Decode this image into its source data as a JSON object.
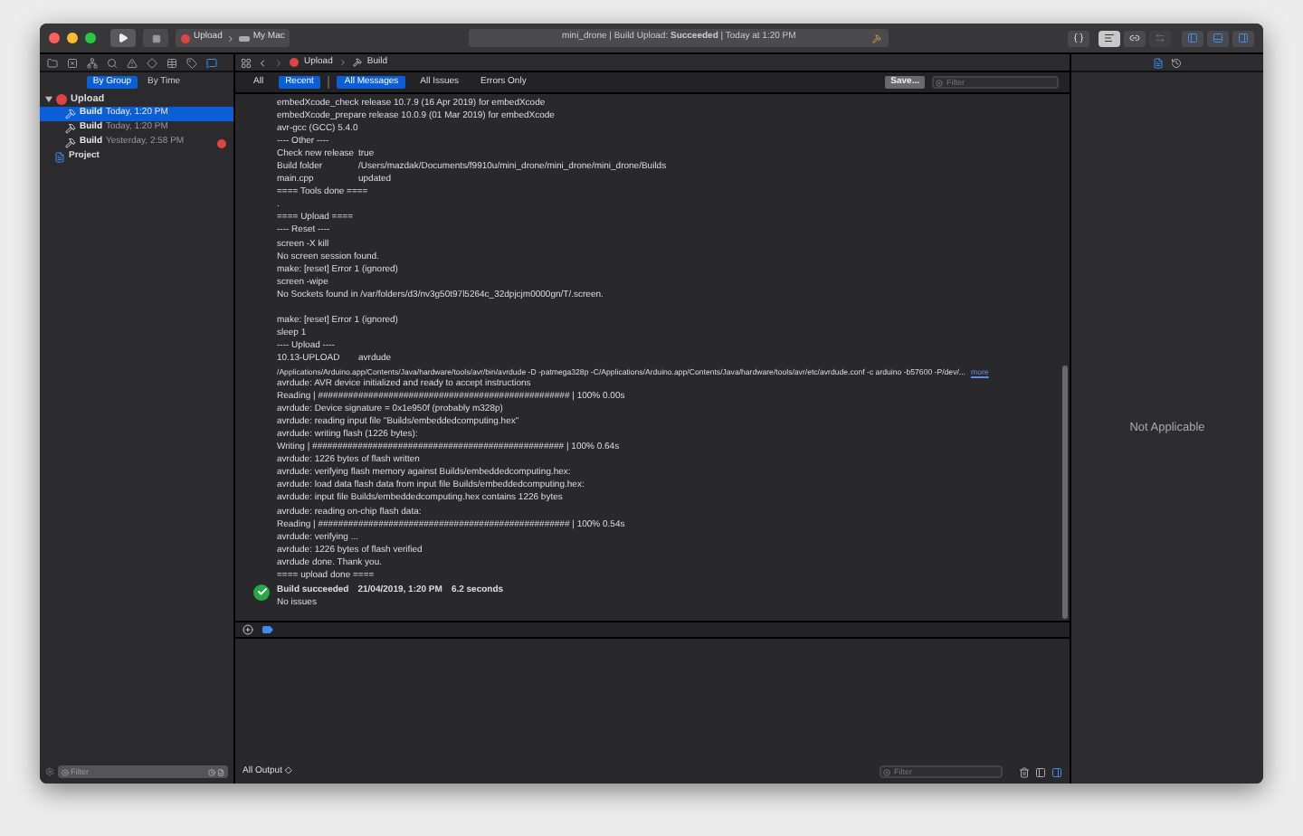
{
  "toolbar": {
    "scheme": {
      "target": "Upload",
      "destination": "My Mac"
    },
    "activity": "mini_drone | Build Upload: **Succeeded** | Today at 1:20 PM"
  },
  "navigator": {
    "scopes": [
      {
        "label": "By Group",
        "selected": true
      },
      {
        "label": "By Time",
        "selected": false
      }
    ],
    "tree": [
      {
        "kind": "group",
        "label": "Upload",
        "expanded": true,
        "children": [
          {
            "kind": "build",
            "label": "Build",
            "time": "Today, 1:20 PM",
            "selected": true,
            "has_error": false
          },
          {
            "kind": "build",
            "label": "Build",
            "time": "Today, 1:20 PM",
            "selected": false,
            "has_error": false
          },
          {
            "kind": "build",
            "label": "Build",
            "time": "Yesterday, 2:58 PM",
            "selected": false,
            "has_error": true
          }
        ]
      },
      {
        "kind": "project",
        "label": "Project"
      }
    ],
    "filter": {
      "placeholder": "Filter"
    }
  },
  "jump_bar": [
    "Upload",
    "Build"
  ],
  "filter_bar": {
    "scopes": [
      {
        "label": "All",
        "selected": false
      },
      {
        "label": "Recent",
        "selected": true
      }
    ],
    "messages": [
      {
        "label": "All Messages",
        "selected": true
      },
      {
        "label": "All Issues",
        "selected": false
      },
      {
        "label": "Errors Only",
        "selected": false
      }
    ],
    "save": "Save...",
    "filter_placeholder": "Filter"
  },
  "log": [
    {
      "kind": "line",
      "text": "embedXcode_check release 10.7.9 (16 Apr 2019) for embedXcode"
    },
    {
      "kind": "line",
      "text": "embedXcode_prepare release 10.0.9 (01 Mar 2019) for embedXcode"
    },
    {
      "kind": "line",
      "text": "avr-gcc (GCC) 5.4.0"
    },
    {
      "kind": "line",
      "text": "---- Other ----"
    },
    {
      "kind": "pair",
      "text": "Check new release",
      "value": "true"
    },
    {
      "kind": "pair",
      "text": "Build folder",
      "value": "/Users/mazdak/Documents/f9910u/mini_drone/mini_drone/mini_drone/Builds"
    },
    {
      "kind": "pair",
      "text": "main.cpp",
      "value": "updated"
    },
    {
      "kind": "line",
      "text": "==== Tools done ===="
    },
    {
      "kind": "line",
      "text": "."
    },
    {
      "kind": "line",
      "text": "==== Upload ===="
    },
    {
      "kind": "line",
      "text": "---- Reset ----"
    },
    {
      "kind": "line",
      "text": "screen -X kill"
    },
    {
      "kind": "line",
      "text": "No screen session found."
    },
    {
      "kind": "line",
      "text": "make: [reset] Error 1 (ignored)"
    },
    {
      "kind": "line",
      "text": "screen -wipe"
    },
    {
      "kind": "line",
      "text": "No Sockets found in /var/folders/d3/nv3g50t97l5264c_32dpjcjm0000gn/T/.screen."
    },
    {
      "kind": "blank"
    },
    {
      "kind": "line",
      "text": "make: [reset] Error 1 (ignored)"
    },
    {
      "kind": "line",
      "text": "sleep 1"
    },
    {
      "kind": "line",
      "text": "---- Upload ----"
    },
    {
      "kind": "pair",
      "text": "10.13-UPLOAD",
      "value": "avrdude"
    },
    {
      "kind": "more",
      "text": "/Applications/Arduino.app/Contents/Java/hardware/tools/avr/bin/avrdude -D -patmega328p -C/Applications/Arduino.app/Contents/Java/hardware/tools/avr/etc/avrdude.conf -c arduino -b57600 -P/dev/...",
      "link": "more"
    },
    {
      "kind": "line",
      "text": "avrdude: AVR device initialized and ready to accept instructions"
    },
    {
      "kind": "line",
      "text": "Reading | ################################################## | 100% 0.00s"
    },
    {
      "kind": "line",
      "text": "avrdude: Device signature = 0x1e950f (probably m328p)"
    },
    {
      "kind": "line",
      "text": "avrdude: reading input file \"Builds/embeddedcomputing.hex\""
    },
    {
      "kind": "line",
      "text": "avrdude: writing flash (1226 bytes):"
    },
    {
      "kind": "line",
      "text": "Writing | ################################################## | 100% 0.64s"
    },
    {
      "kind": "line",
      "text": "avrdude: 1226 bytes of flash written"
    },
    {
      "kind": "line",
      "text": "avrdude: verifying flash memory against Builds/embeddedcomputing.hex:"
    },
    {
      "kind": "line",
      "text": "avrdude: load data flash data from input file Builds/embeddedcomputing.hex:"
    },
    {
      "kind": "line",
      "text": "avrdude: input file Builds/embeddedcomputing.hex contains 1226 bytes"
    },
    {
      "kind": "line",
      "text": "avrdude: reading on-chip flash data:"
    },
    {
      "kind": "line",
      "text": "Reading | ################################################## | 100% 0.54s"
    },
    {
      "kind": "line",
      "text": "avrdude: verifying ..."
    },
    {
      "kind": "line",
      "text": "avrdude: 1226 bytes of flash verified"
    },
    {
      "kind": "line",
      "text": "avrdude done.  Thank you."
    },
    {
      "kind": "line",
      "text": "==== upload done ===="
    }
  ],
  "summary": {
    "status": "Build succeeded",
    "date": "21/04/2019, 1:20 PM",
    "duration": "6.2 seconds",
    "issues": "No issues"
  },
  "console": {
    "output_menu": "All Output ◇",
    "filter_placeholder": "Filter"
  },
  "inspector": {
    "message": "Not Applicable"
  }
}
